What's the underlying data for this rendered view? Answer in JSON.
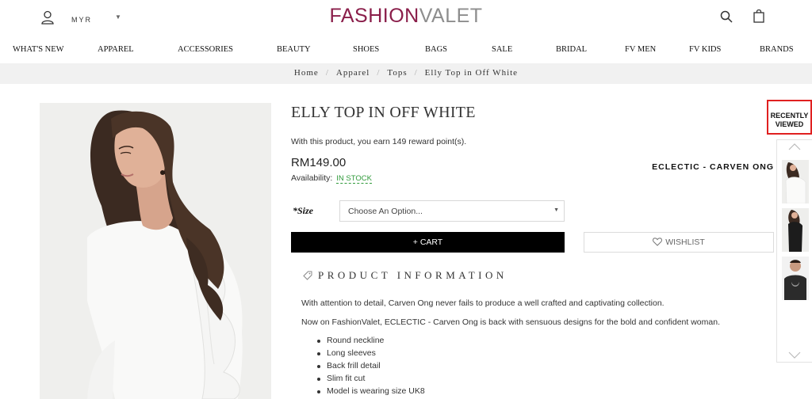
{
  "header": {
    "currency": "MYR",
    "logo_part1": "FASHION",
    "logo_part2": "VALET",
    "icons": [
      "user-icon",
      "chevron-down-icon",
      "search-icon",
      "shopping-bag-icon"
    ]
  },
  "nav": {
    "items": [
      "WHAT'S NEW",
      "APPAREL",
      "ACCESSORIES",
      "BEAUTY",
      "SHOES",
      "BAGS",
      "SALE",
      "BRIDAL",
      "FV MEN",
      "FV KIDS",
      "BRANDS"
    ]
  },
  "breadcrumb": {
    "items": [
      "Home",
      "Apparel",
      "Tops",
      "Elly Top in Off White"
    ],
    "separator": "/"
  },
  "product": {
    "title": "ELLY TOP IN OFF WHITE",
    "reward_text": "With this product, you earn 149 reward point(s).",
    "price": "RM149.00",
    "availability_label": "Availability:",
    "availability_value": "IN STOCK",
    "brand": "ECLECTIC - CARVEN ONG",
    "size_label": "*Size",
    "size_placeholder": "Choose An Option...",
    "cart_label": "+ CART",
    "wishlist_label": "WISHLIST",
    "info_heading": "PRODUCT INFORMATION",
    "description_1": "With attention to detail, Carven Ong never fails to produce a well crafted and captivating collection.",
    "description_2": "Now on FashionValet, ECLECTIC - Carven Ong is back with sensuous designs for the bold and confident woman.",
    "features": [
      "Round neckline",
      "Long sleeves",
      "Back frill detail",
      "Slim fit cut",
      "Model is wearing size UK8"
    ]
  },
  "recently_viewed": {
    "label_line1": "RECENTLY",
    "label_line2": "VIEWED",
    "thumbnail_count": 3
  },
  "colors": {
    "logo_primary": "#8a1e4a",
    "logo_secondary": "#8d8d8d",
    "in_stock": "#2f9a3a",
    "highlight_border": "#e02020",
    "cart_button": "#000000"
  }
}
